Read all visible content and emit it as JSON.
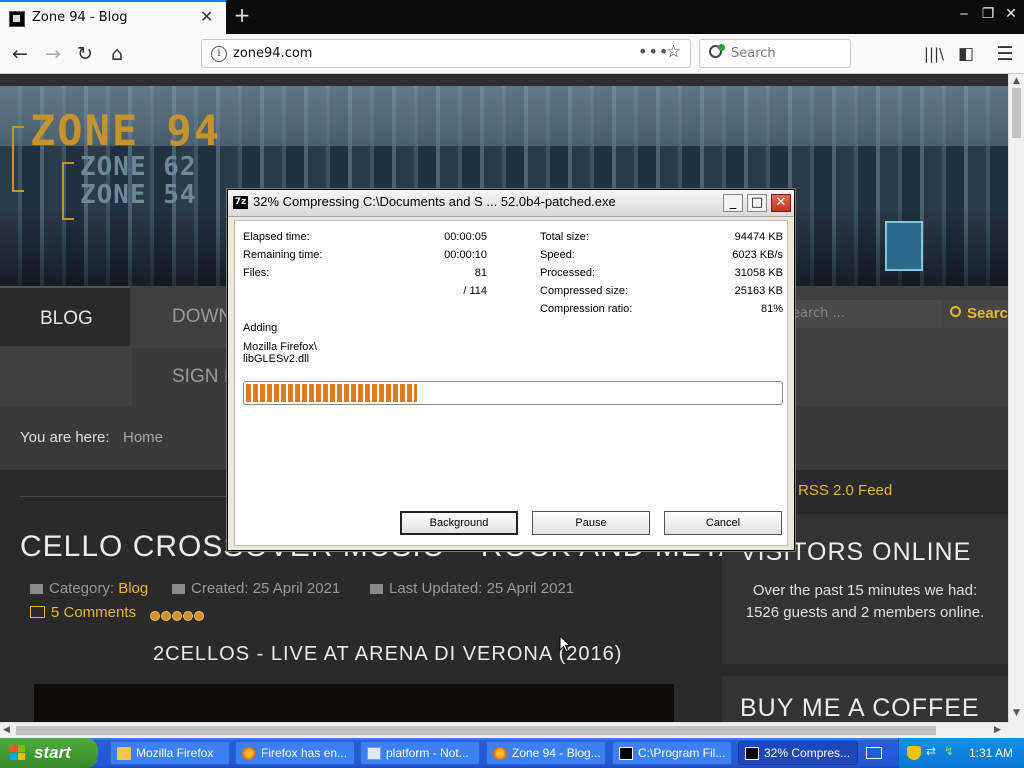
{
  "browser": {
    "tab_title": "Zone 94 - Blog",
    "url": "zone94.com",
    "search_placeholder": "Search"
  },
  "site": {
    "logo_main": "ZONE 94",
    "logo_sub1": "ZONE 62",
    "logo_sub2": "ZONE 54",
    "nav": {
      "blog": "BLOG",
      "downloads": "DOWN",
      "sign_in": "SIGN I"
    },
    "site_search_placeholder": "earch ...",
    "site_search_button": "Search",
    "breadcrumb_label": "You are here:",
    "breadcrumb_home": "Home",
    "rss": "RSS 2.0 Feed",
    "article": {
      "title": "CELLO CROSSOVER MUSIC – ROCK AND METAL",
      "category_label": "Category:",
      "category": "Blog",
      "created": "Created: 25 April 2021",
      "updated": "Last Updated: 25 April 2021",
      "comments": "5 Comments",
      "rating": 5,
      "video_title": "2CELLOS - LIVE AT ARENA DI VERONA (2016)"
    },
    "sidebar": {
      "visitors_title": "VISITORS ONLINE",
      "visitors_text": "Over the past 15 minutes we had: 1526 guests and 2 members online.",
      "coffee_title": "BUY ME A COFFEE"
    }
  },
  "dialog": {
    "title": "32% Compressing C:\\Documents and S ... 52.0b4-patched.exe",
    "elapsed_label": "Elapsed time:",
    "elapsed": "00:00:05",
    "remaining_label": "Remaining time:",
    "remaining": "00:00:10",
    "files_label": "Files:",
    "files": "81",
    "files_total": "/ 114",
    "total_size_label": "Total size:",
    "total_size": "94474 KB",
    "speed_label": "Speed:",
    "speed": "6023 KB/s",
    "processed_label": "Processed:",
    "processed": "31058 KB",
    "compressed_label": "Compressed size:",
    "compressed": "25163 KB",
    "ratio_label": "Compression ratio:",
    "ratio": "81%",
    "adding_label": "Adding",
    "file_path_1": "Mozilla Firefox\\",
    "file_path_2": "libGLESv2.dll",
    "progress_percent": 32,
    "buttons": {
      "background": "Background",
      "pause": "Pause",
      "cancel": "Cancel"
    }
  },
  "taskbar": {
    "start": "start",
    "items": [
      "Mozilla Firefox",
      "Firefox has en...",
      "platform - Not...",
      "Zone 94 - Blog...",
      "C:\\Program Fil...",
      "32% Compres..."
    ],
    "clock": "1:31 AM"
  }
}
